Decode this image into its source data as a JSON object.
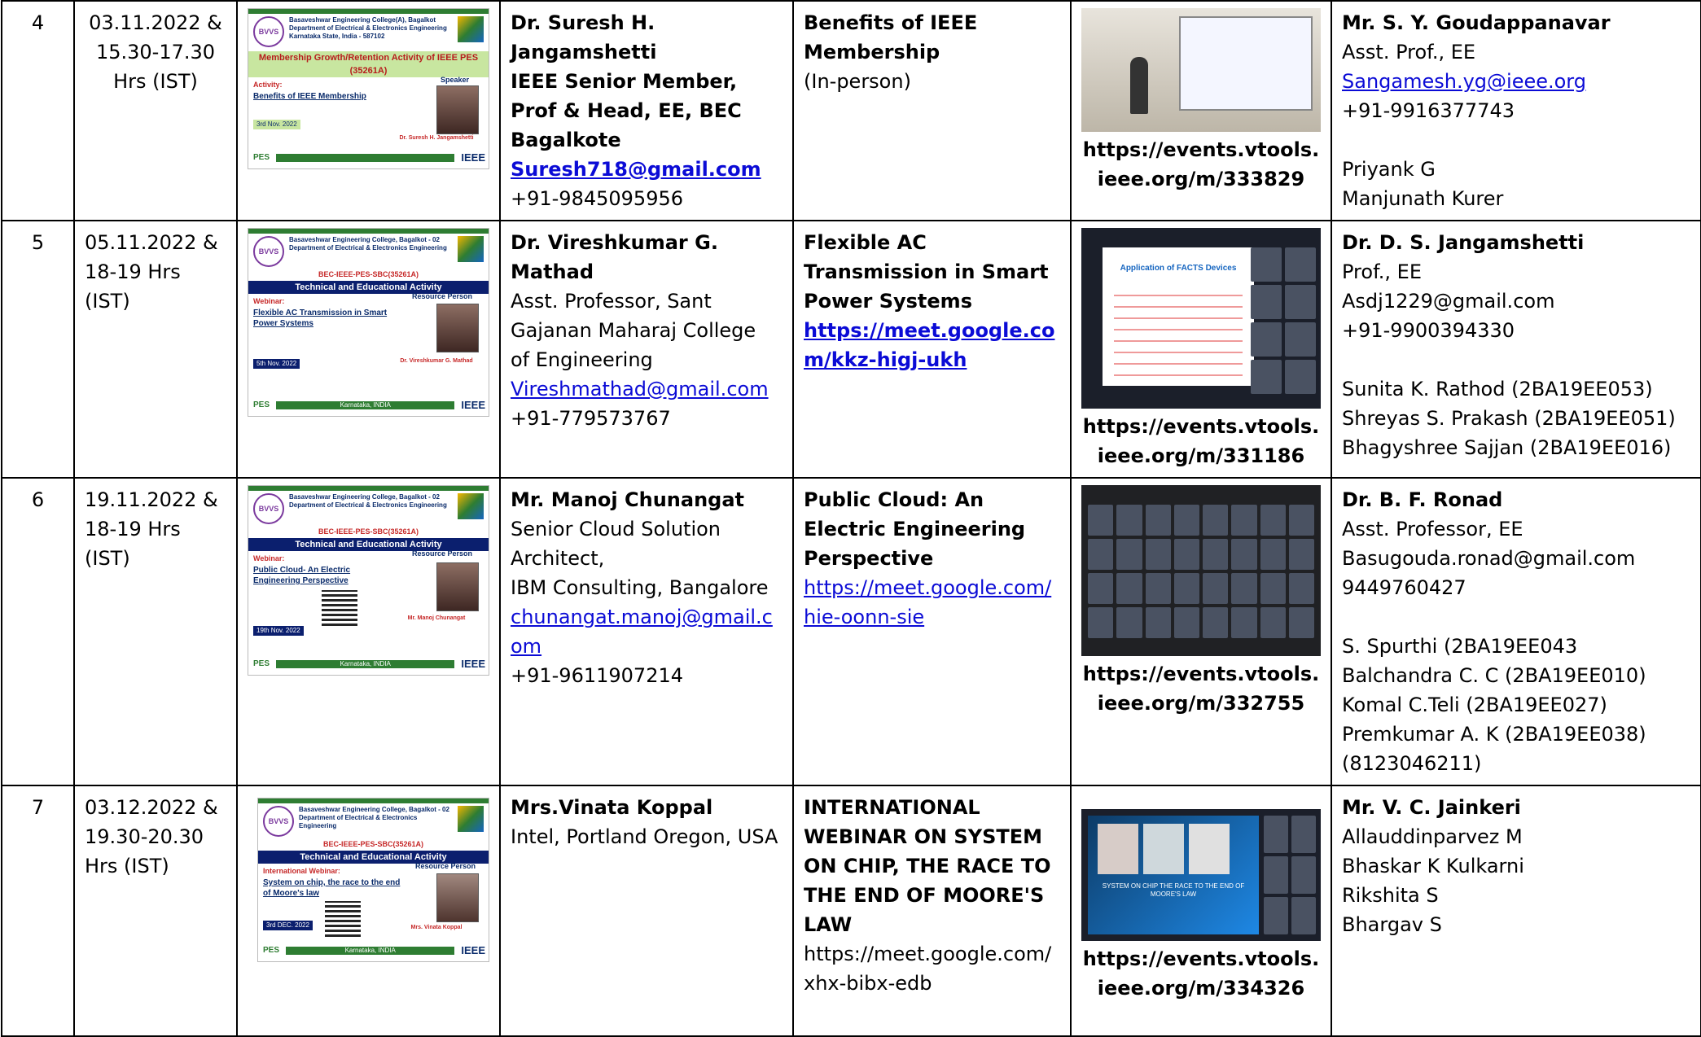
{
  "rows": [
    {
      "sno": "4",
      "date": [
        "03.11.2022 &",
        "15.30-17.30",
        "Hrs (IST)"
      ],
      "poster": {
        "lines": [
          "Basaveshwar Engineering College(A), Bagalkot",
          "Department of Electrical & Electronics Engineering",
          "Karnataka State, India - 587102"
        ],
        "band": "Membership Growth/Retention Activity of IEEE PES (35261A)",
        "activity_label": "Activity:",
        "title": "Benefits of IEEE Membership",
        "role": "Speaker",
        "person": "Dr. Suresh H. Jangamshetti",
        "date": "3rd Nov. 2022",
        "footer_left": "PES",
        "footer_right": "IEEE"
      },
      "resource": {
        "name": "Dr. Suresh H. Jangamshetti",
        "details": [
          "IEEE Senior Member,",
          "Prof & Head, EE, BEC",
          "Bagalkote"
        ],
        "email": "Suresh718@gmail.com",
        "phone": "+91-9845095956"
      },
      "topic": {
        "title": "Benefits of IEEE Membership",
        "mode": "(In-person)"
      },
      "link": "https://events.vtools.ieee.org/m/333829",
      "coordinator": {
        "name": "Mr. S. Y. Goudappanavar",
        "role": "Asst. Prof., EE",
        "email": "Sangamesh.yg@ieee.org",
        "phone": "+91-9916377743",
        "students": [
          "Priyank G",
          "Manjunath Kurer"
        ]
      }
    },
    {
      "sno": "5",
      "date": [
        "05.11.2022 &",
        "18-19 Hrs",
        "(IST)"
      ],
      "poster": {
        "lines": [
          "Basaveshwar Engineering College, Bagalkot - 02",
          "Department of Electrical & Electronics Engineering"
        ],
        "sub": "BEC-IEEE-PES-SBC(35261A)",
        "band": "Technical and Educational Activity",
        "activity_label": "Webinar:",
        "title": "Flexible AC Transmission in Smart Power Systems",
        "role": "Resource Person",
        "person": "Dr. Vireshkumar G. Mathad",
        "date": "5th Nov. 2022",
        "footer_left": "PES",
        "footer_mid": "Karnataka, INDIA",
        "footer_right": "IEEE"
      },
      "resource": {
        "name": "Dr. Vireshkumar G. Mathad",
        "details": [
          "Asst. Professor, Sant",
          "Gajanan Maharaj College",
          "of Engineering"
        ],
        "email": "Vireshmathad@gmail.com",
        "phone": "+91-779573767"
      },
      "topic": {
        "title": "Flexible AC Transmission in Smart Power Systems",
        "url": "https://meet.google.com/kkz-higj-ukh"
      },
      "link": "https://events.vtools.ieee.org/m/331186",
      "photo_caption": "Application of FACTS Devices",
      "coordinator": {
        "name": "Dr. D. S. Jangamshetti",
        "role": "Prof., EE",
        "email": "Asdj1229@gmail.com",
        "phone": "+91-9900394330",
        "students": [
          "Sunita K. Rathod (2BA19EE053)",
          "Shreyas S. Prakash (2BA19EE051)",
          "Bhagyshree Sajjan (2BA19EE016)"
        ]
      }
    },
    {
      "sno": "6",
      "date": [
        "19.11.2022 &",
        "18-19 Hrs",
        "(IST)"
      ],
      "poster": {
        "lines": [
          "Basaveshwar Engineering College, Bagalkot - 02",
          "Department of Electrical & Electronics Engineering"
        ],
        "sub": "BEC-IEEE-PES-SBC(35261A)",
        "band": "Technical and Educational Activity",
        "activity_label": "Webinar:",
        "title": "Public Cloud- An Electric Engineering Perspective",
        "role": "Resource Person",
        "person": "Mr. Manoj Chunangat",
        "date": "19th Nov. 2022",
        "footer_left": "PES",
        "footer_mid": "Karnataka, INDIA",
        "footer_right": "IEEE"
      },
      "resource": {
        "name": "Mr. Manoj  Chunangat",
        "details": [
          "Senior Cloud Solution",
          "Architect,",
          "IBM Consulting, Bangalore"
        ],
        "email": "chunangat.manoj@gmail.com",
        "phone": "+91-9611907214"
      },
      "topic": {
        "title": "Public Cloud: An Electric Engineering Perspective",
        "url": "https://meet.google.com/hie-oonn-sie"
      },
      "link": "https://events.vtools.ieee.org/m/332755",
      "coordinator": {
        "name": "Dr. B. F. Ronad",
        "role": "Asst. Professor, EE",
        "email": "Basugouda.ronad@gmail.com",
        "phone": "9449760427",
        "students": [
          "S. Spurthi (2BA19EE043",
          "Balchandra C. C (2BA19EE010)",
          "Komal C.Teli (2BA19EE027)",
          "Premkumar A. K (2BA19EE038)",
          "(8123046211)"
        ]
      }
    },
    {
      "sno": "7",
      "date": [
        "03.12.2022 &",
        "19.30-20.30",
        "Hrs (IST)"
      ],
      "poster": {
        "lines": [
          "Basaveshwar Engineering College, Bagalkot - 02",
          "Department of Electrical & Electronics Engineering"
        ],
        "sub": "BEC-IEEE-PES-SBC(35261A)",
        "band": "Technical and Educational Activity",
        "activity_label": "International Webinar:",
        "title": "System on chip, the race to the end of Moore's law",
        "role": "Resource Person",
        "person": "Mrs. Vinata Koppal",
        "date": "3rd DEC. 2022",
        "footer_left": "PES",
        "footer_mid": "Karnataka, INDIA",
        "footer_right": "IEEE"
      },
      "resource": {
        "name": "Mrs.Vinata Koppal",
        "details": [
          "Intel, Portland Oregon, USA"
        ],
        "email": "",
        "phone": ""
      },
      "topic": {
        "title": "INTERNATIONAL WEBINAR ON SYSTEM ON CHIP, THE RACE TO THE END OF MOORE'S LAW",
        "url": "https://meet.google.com/xhx-bibx-edb"
      },
      "link": "https://events.vtools.ieee.org/m/334326",
      "photo_caption": "SYSTEM ON CHIP THE RACE TO THE END OF MOORE'S LAW",
      "coordinator": {
        "name": "Mr. V. C. Jainkeri",
        "role": "",
        "email": "",
        "phone": "",
        "students": [
          "Allauddinparvez M",
          "Bhaskar K Kulkarni",
          "Rikshita S",
          "Bhargav S"
        ]
      }
    }
  ]
}
